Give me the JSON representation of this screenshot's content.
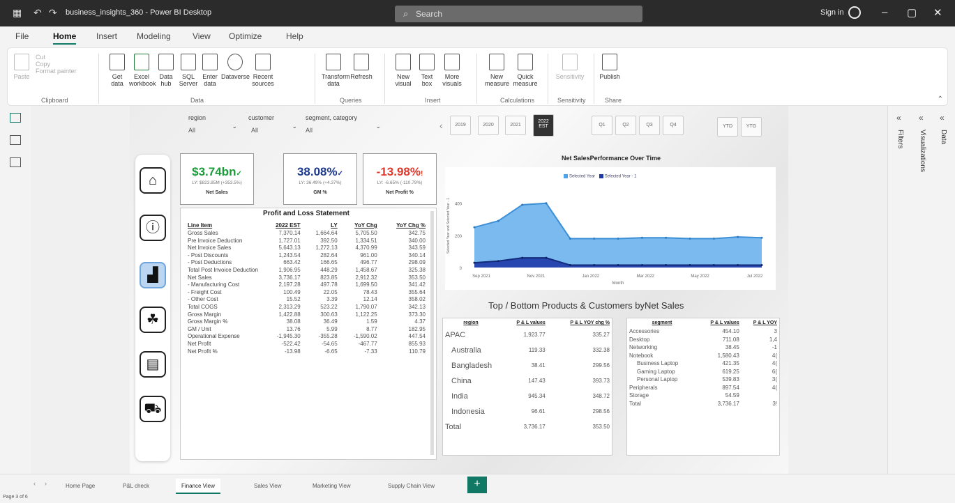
{
  "app": {
    "title": "business_insights_360 - Power BI Desktop",
    "search_placeholder": "Search",
    "signin": "Sign in"
  },
  "menu": [
    "File",
    "Home",
    "Insert",
    "Modeling",
    "View",
    "Optimize",
    "Help"
  ],
  "ribbon": {
    "clipboard": {
      "paste": "Paste",
      "cut": "Cut",
      "copy": "Copy",
      "format_painter": "Format painter",
      "group": "Clipboard"
    },
    "data": {
      "items": [
        "Get data",
        "Excel workbook",
        "Data hub",
        "SQL Server",
        "Enter data",
        "Dataverse",
        "Recent sources"
      ],
      "group": "Data"
    },
    "queries": {
      "items": [
        "Transform data",
        "Refresh"
      ],
      "group": "Queries"
    },
    "insert": {
      "items": [
        "New visual",
        "Text box",
        "More visuals"
      ],
      "group": "Insert"
    },
    "calculations": {
      "items": [
        "New measure",
        "Quick measure"
      ],
      "group": "Calculations"
    },
    "sensitivity": {
      "items": [
        "Sensitivity"
      ],
      "group": "Sensitivity"
    },
    "share": {
      "items": [
        "Publish"
      ],
      "group": "Share"
    }
  },
  "slicers": [
    {
      "label": "region",
      "value": "All"
    },
    {
      "label": "customer",
      "value": "All"
    },
    {
      "label": "segment, category",
      "value": "All"
    }
  ],
  "year_buttons": [
    "2019",
    "2020",
    "2021",
    "2022 EST"
  ],
  "quarter_buttons": [
    "Q1",
    "Q2",
    "Q3",
    "Q4"
  ],
  "ytd_buttons": [
    "YTD",
    "YTG"
  ],
  "kpis": [
    {
      "value": "$3.74bn",
      "sub": "LY: $823.85M (+353.5%)",
      "label": "Net Sales",
      "color": "#1a9b3a",
      "mark": "✓"
    },
    {
      "value": "38.08%",
      "sub": "LY: 36.49% (+4.37%)",
      "label": "GM %",
      "color": "#1f3a8f",
      "mark": "✓"
    },
    {
      "value": "-13.98%",
      "sub": "LY: -6.65% (-110.79%)",
      "label": "Net Profit %",
      "color": "#e0392b",
      "mark": "!"
    }
  ],
  "pl": {
    "title": "Profit and Loss Statement",
    "headers": [
      "Line Item",
      "2022 EST",
      "LY",
      "YoY Chg",
      "YoY Chg %"
    ],
    "rows": [
      [
        "Gross Sales",
        "7,370.14",
        "1,664.64",
        "5,705.50",
        "342.75"
      ],
      [
        "Pre Invoice Deduction",
        "1,727.01",
        "392.50",
        "1,334.51",
        "340.00"
      ],
      [
        "Net Invoice Sales",
        "5,643.13",
        "1,272.13",
        "4,370.99",
        "343.59"
      ],
      [
        "- Post Discounts",
        "1,243.54",
        "282.64",
        "961.00",
        "340.14"
      ],
      [
        "- Post Deductions",
        "663.42",
        "166.65",
        "496.77",
        "298.09"
      ],
      [
        "Total Post Invoice Deduction",
        "1,906.95",
        "448.29",
        "1,458.67",
        "325.38"
      ],
      [
        "Net Sales",
        "3,736.17",
        "823.85",
        "2,912.32",
        "353.50"
      ],
      [
        "- Manufacturing Cost",
        "2,197.28",
        "497.78",
        "1,699.50",
        "341.42"
      ],
      [
        "- Freight Cost",
        "100.49",
        "22.05",
        "78.43",
        "355.64"
      ],
      [
        "- Other Cost",
        "15.52",
        "3.39",
        "12.14",
        "358.02"
      ],
      [
        "Total COGS",
        "2,313.29",
        "523.22",
        "1,790.07",
        "342.13"
      ],
      [
        "Gross Margin",
        "1,422.88",
        "300.63",
        "1,122.25",
        "373.30"
      ],
      [
        "Gross Margin %",
        "38.08",
        "36.49",
        "1.59",
        "4.37"
      ],
      [
        "GM / Unit",
        "13.76",
        "5.99",
        "8.77",
        "182.95"
      ],
      [
        "Operational Expense",
        "-1,945.30",
        "-355.28",
        "-1,590.02",
        "447.54"
      ],
      [
        "Net Profit",
        "-522.42",
        "-54.65",
        "-467.77",
        "855.93"
      ],
      [
        "Net Profit %",
        "-13.98",
        "-6.65",
        "-7.33",
        "110.79"
      ]
    ]
  },
  "chart_data": {
    "type": "area",
    "title": "Net SalesPerformance Over Time",
    "xlabel": "Month",
    "ylabel": "Selected Year and Selected Year - 1",
    "x_ticks": [
      "Sep 2021",
      "Nov 2021",
      "Jan 2022",
      "Mar 2022",
      "May 2022",
      "Jul 2022"
    ],
    "y_ticks": [
      "0",
      "200",
      "400"
    ],
    "ylim": [
      0,
      520
    ],
    "series": [
      {
        "name": "Selected Year",
        "color": "#4ea3ea",
        "values": [
          250,
          290,
          390,
          400,
          180,
          180,
          180,
          185,
          185,
          180,
          180,
          190,
          185
        ]
      },
      {
        "name": "Selected Year - 1",
        "color": "#1f3aa8",
        "values": [
          30,
          40,
          60,
          60,
          15,
          15,
          15,
          15,
          15,
          15,
          15,
          15,
          15
        ]
      }
    ]
  },
  "top_bottom_title": "Top / Bottom Products & Customers byNet Sales",
  "region_table": {
    "headers": [
      "region",
      "P & L values",
      "P & L YOY chg %"
    ],
    "rows": [
      [
        "APAC",
        "1,923.77",
        "335.27"
      ],
      [
        "Australia",
        "119.33",
        "332.38"
      ],
      [
        "Bangladesh",
        "38.41",
        "299.56"
      ],
      [
        "China",
        "147.43",
        "393.73"
      ],
      [
        "India",
        "945.34",
        "348.72"
      ],
      [
        "Indonesia",
        "96.61",
        "298.56"
      ],
      [
        "Total",
        "3,736.17",
        "353.50"
      ]
    ]
  },
  "segment_table": {
    "headers": [
      "segment",
      "P & L values",
      "P & L YOY"
    ],
    "rows": [
      [
        "Accessories",
        "454.10",
        "3"
      ],
      [
        "Desktop",
        "711.08",
        "1,4"
      ],
      [
        "Networking",
        "38.45",
        "-1"
      ],
      [
        "Notebook",
        "1,580.43",
        "4("
      ],
      [
        "Business Laptop",
        "421.35",
        "4("
      ],
      [
        "Gaming Laptop",
        "619.25",
        "6("
      ],
      [
        "Personal Laptop",
        "539.83",
        "3("
      ],
      [
        "Peripherals",
        "897.54",
        "4("
      ],
      [
        "Storage",
        "54.59",
        ""
      ],
      [
        "Total",
        "3,736.17",
        "3!"
      ]
    ]
  },
  "right_panes": [
    "Filters",
    "Visualizations",
    "Data"
  ],
  "tabs": [
    "Home Page",
    "P&L check",
    "Finance View",
    "Sales View",
    "Marketing View",
    "Supply Chain View"
  ],
  "status": "Page 3 of 6"
}
